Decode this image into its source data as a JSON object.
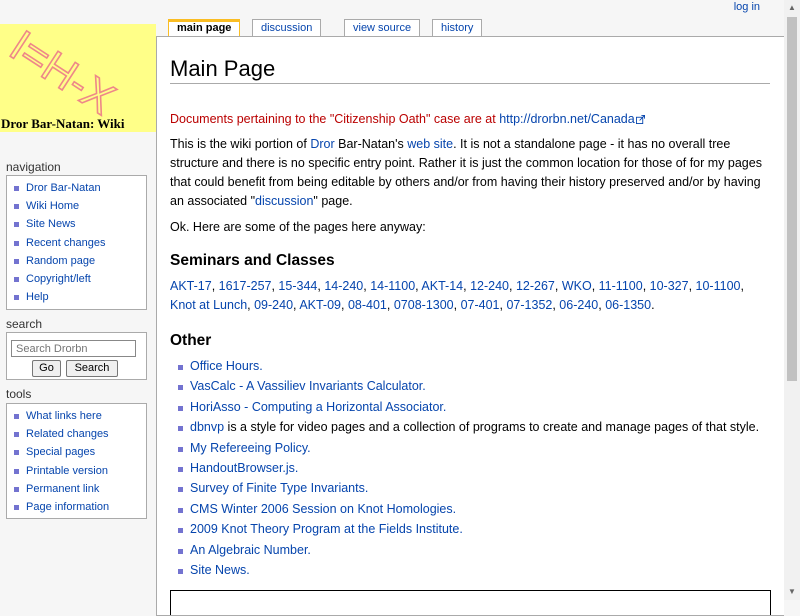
{
  "logo": {
    "text": "I=H-X",
    "wiki_name": "Dror Bar-Natan: Wiki"
  },
  "user": {
    "login": "log in"
  },
  "tabs": {
    "main_page": "main page",
    "discussion": "discussion",
    "view_source": "view source",
    "history": "history"
  },
  "navigation": {
    "title": "navigation",
    "items": [
      "Dror Bar-Natan",
      "Wiki Home",
      "Site News",
      "Recent changes",
      "Random page",
      "Copyright/left",
      "Help"
    ]
  },
  "search": {
    "title": "search",
    "placeholder": "Search Drorbn",
    "go": "Go",
    "search": "Search"
  },
  "tools": {
    "title": "tools",
    "items": [
      "What links here",
      "Related changes",
      "Special pages",
      "Printable version",
      "Permanent link",
      "Page information"
    ]
  },
  "content": {
    "title": "Main Page",
    "notice_text": "Documents pertaining to the \"Citizenship Oath\" case are at ",
    "notice_link": "http://drorbn.net/Canada",
    "intro": {
      "t1": "This is the wiki portion of ",
      "l1": "Dror",
      "t2": " Bar-Natan's ",
      "l2": "web site",
      "t3": ". It is not a standalone page - it has no overall tree structure and there is no specific entry point. Rather it is just the common location for those of for my pages that could benefit from being editable by others and/or from having their history preserved and/or by having an associated \"",
      "l3": "discussion",
      "t4": "\" page."
    },
    "ok_text": "Ok. Here are some of the pages here anyway:",
    "seminars_heading": "Seminars and Classes",
    "seminars": [
      "AKT-17",
      "1617-257",
      "15-344",
      "14-240",
      "14-1100",
      "AKT-14",
      "12-240",
      "12-267",
      "WKO",
      "11-1100",
      "10-327",
      "10-1100",
      "Knot at Lunch",
      "09-240",
      "AKT-09",
      "08-401",
      "0708-1300",
      "07-401",
      "07-1352",
      "06-240",
      "06-1350"
    ],
    "other_heading": "Other",
    "other": [
      {
        "link": "Office Hours.",
        "rest": ""
      },
      {
        "link": "VasCalc - A Vassiliev Invariants Calculator.",
        "rest": ""
      },
      {
        "link": "HoriAsso - Computing a Horizontal Associator.",
        "rest": ""
      },
      {
        "link": "dbnvp",
        "rest": " is a style for video pages and a collection of programs to create and manage pages of that style."
      },
      {
        "link": "My Refereeing Policy.",
        "rest": ""
      },
      {
        "link": "HandoutBrowser.js.",
        "rest": ""
      },
      {
        "link": "Survey of Finite Type Invariants.",
        "rest": ""
      },
      {
        "link": "CMS Winter 2006 Session on Knot Homologies.",
        "rest": ""
      },
      {
        "link": "2009 Knot Theory Program at the Fields Institute.",
        "rest": ""
      },
      {
        "link": "An Algebraic Number.",
        "rest": ""
      },
      {
        "link": "Site News.",
        "rest": ""
      }
    ]
  },
  "colors": {
    "link": "#0645ad",
    "notice": "#ba0000",
    "logo_bg": "#ffff88",
    "tab_selected": "#fabd23"
  }
}
